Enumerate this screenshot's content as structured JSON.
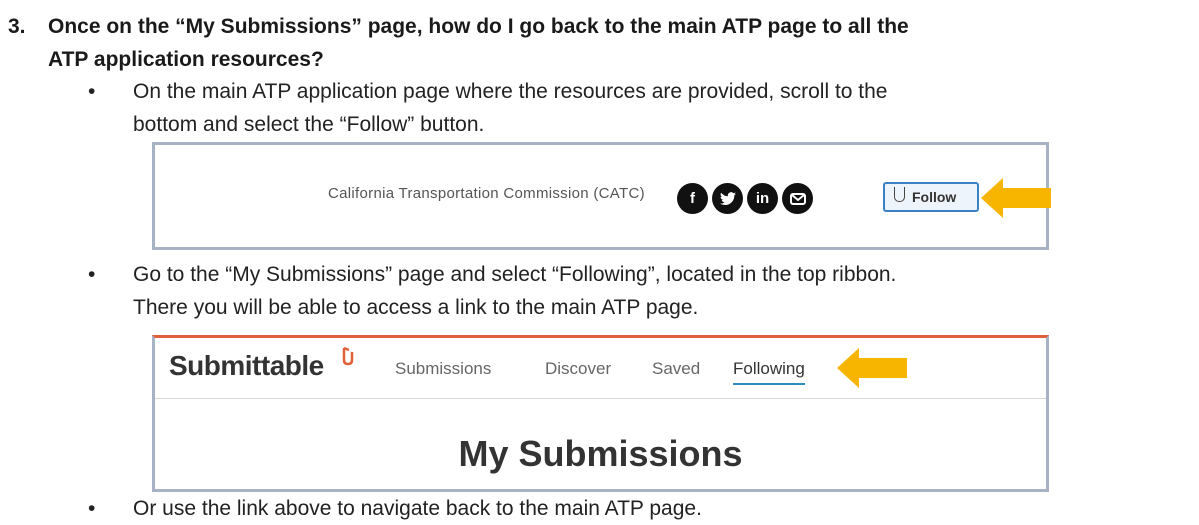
{
  "question": {
    "number": "3.",
    "line1": "Once on the “My Submissions” page, how do I go back to the main ATP page to all the",
    "line2": "ATP application resources?"
  },
  "bullets": [
    {
      "symbol": "•",
      "line1": "On the main ATP application page where the resources are provided, scroll to the",
      "line2": "bottom and select the “Follow” button."
    },
    {
      "symbol": "•",
      "line1": "Go to the “My Submissions” page and select “Following”, located in the top ribbon.",
      "line2": "There you will be able to access a link to the main ATP page."
    },
    {
      "symbol": "•",
      "line1": "Or use the link above to navigate back to the main ATP page."
    }
  ],
  "footer_screenshot": {
    "org_text": "California Transportation Commission (CATC)",
    "social_icons": [
      {
        "name": "facebook-icon",
        "glyph": "f"
      },
      {
        "name": "twitter-icon",
        "glyph": "🕊"
      },
      {
        "name": "linkedin-icon",
        "glyph": "in"
      },
      {
        "name": "email-icon",
        "glyph": "✉"
      }
    ],
    "follow_label": "Follow"
  },
  "submittable_screenshot": {
    "logo_text": "Submittable",
    "nav_items": [
      "Submissions",
      "Discover",
      "Saved",
      "Following"
    ],
    "active_item": "Following",
    "page_title": "My Submissions"
  },
  "colors": {
    "arrow": "#f7b500",
    "border": "#a7b2c4",
    "brand": "#e0603a",
    "active_underline": "#2e8bc0"
  }
}
